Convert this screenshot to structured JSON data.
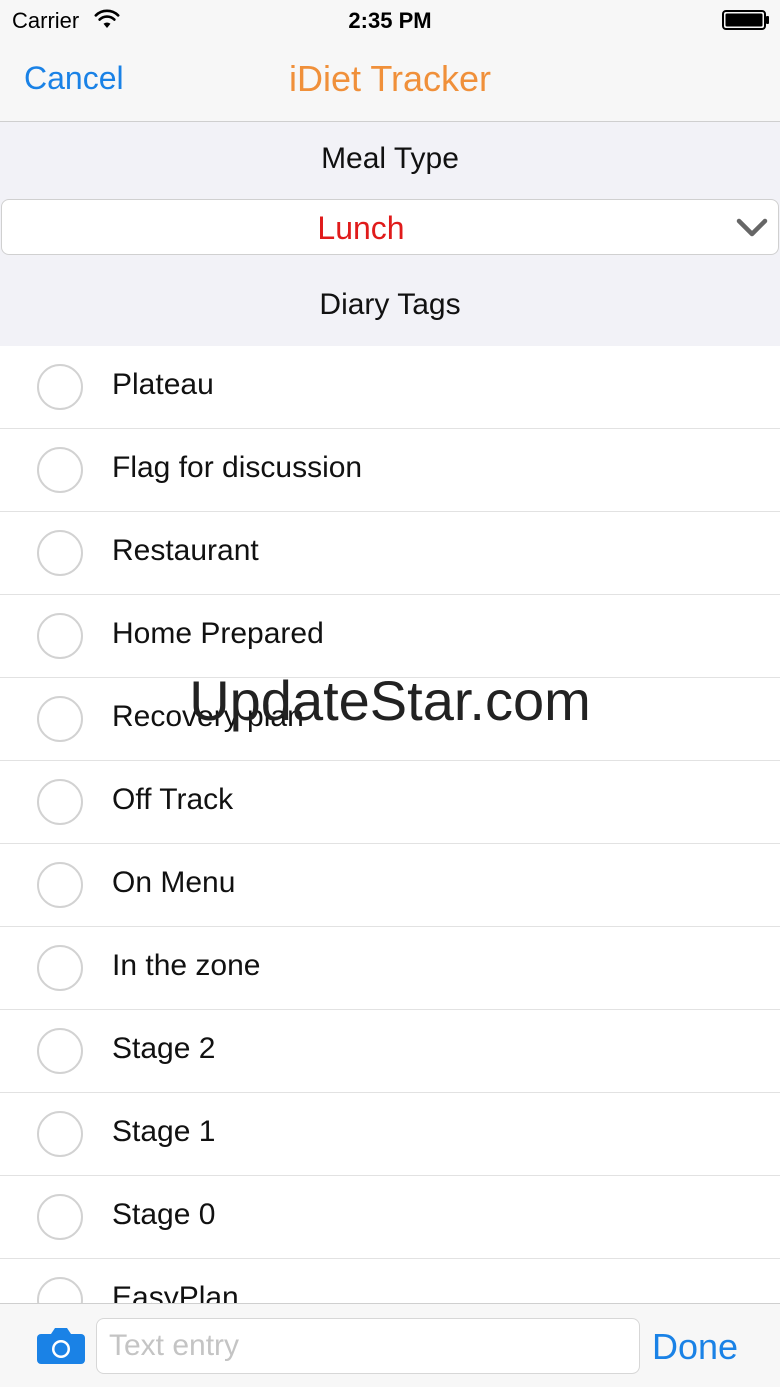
{
  "status_bar": {
    "carrier": "Carrier",
    "time": "2:35 PM",
    "icons": [
      "wifi-icon",
      "battery-icon"
    ]
  },
  "nav": {
    "cancel_label": "Cancel",
    "title": "iDiet Tracker",
    "title_color": "#f0903a",
    "accent_color": "#1a82e6"
  },
  "meal_type": {
    "header": "Meal Type",
    "selected": "Lunch",
    "selected_color": "#e01b1b",
    "icon": "chevron-down-icon"
  },
  "diary_tags": {
    "header": "Diary Tags",
    "items": [
      {
        "label": "Plateau",
        "checked": false
      },
      {
        "label": "Flag for discussion",
        "checked": false
      },
      {
        "label": "Restaurant",
        "checked": false
      },
      {
        "label": "Home Prepared",
        "checked": false
      },
      {
        "label": "Recovery plan",
        "checked": false
      },
      {
        "label": "Off Track",
        "checked": false
      },
      {
        "label": "On Menu",
        "checked": false
      },
      {
        "label": "In the zone",
        "checked": false
      },
      {
        "label": "Stage 2",
        "checked": false
      },
      {
        "label": "Stage 1",
        "checked": false
      },
      {
        "label": "Stage 0",
        "checked": false
      },
      {
        "label": "EasyPlan",
        "checked": false
      }
    ]
  },
  "watermark": "UpdateStar.com",
  "bottom_bar": {
    "camera_icon": "camera-icon",
    "text_entry_placeholder": "Text entry",
    "text_entry_value": "",
    "done_label": "Done"
  }
}
